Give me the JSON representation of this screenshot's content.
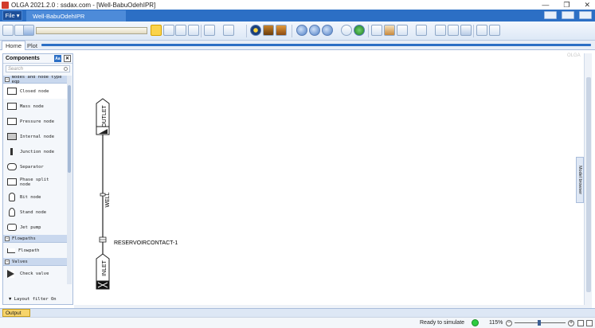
{
  "window": {
    "title": "OLGA 2021.2.0 : ssdax.com - [Well-BabuOdehIPR]",
    "minimize": "—",
    "restore": "❐",
    "close": "✕"
  },
  "menu": {
    "file_label": "File ▾",
    "document_tab": "Well-BabuOdehIPR"
  },
  "ribbon_tabs": [
    {
      "label": "Home",
      "active": true
    },
    {
      "label": "Plot",
      "active": false
    }
  ],
  "components_panel": {
    "title": "Components",
    "aa_label": "Aa",
    "close_label": "✕",
    "search_placeholder": "Search",
    "categories": [
      {
        "label": "Nodes and node type eqp",
        "items": [
          "Closed node",
          "Mass node",
          "Pressure node",
          "Internal node",
          "Junction node",
          "Separator",
          "Phase split node",
          "Bit node",
          "Stand node",
          "Jet pump"
        ]
      },
      {
        "label": "Flowpaths",
        "items": [
          "Flowpath"
        ]
      },
      {
        "label": "Valves",
        "items": [
          "Check valve"
        ]
      }
    ],
    "layout_filter": "Layout filter On"
  },
  "canvas": {
    "outlet_label": "OUTLET",
    "flowpath_label": "WELL",
    "reservoir_label": "RESERVOIRCONTACT-1",
    "inlet_label": "INLET",
    "watermark": "OLGA"
  },
  "model_browser": "Model browser",
  "output_tab": "Output",
  "status": {
    "text": "Ready to simulate",
    "indicator_color": "#2ecc40",
    "zoom": "115%"
  },
  "colors": {
    "accent": "#2c6fc5",
    "toolbar_selected": "#fbd34b"
  }
}
